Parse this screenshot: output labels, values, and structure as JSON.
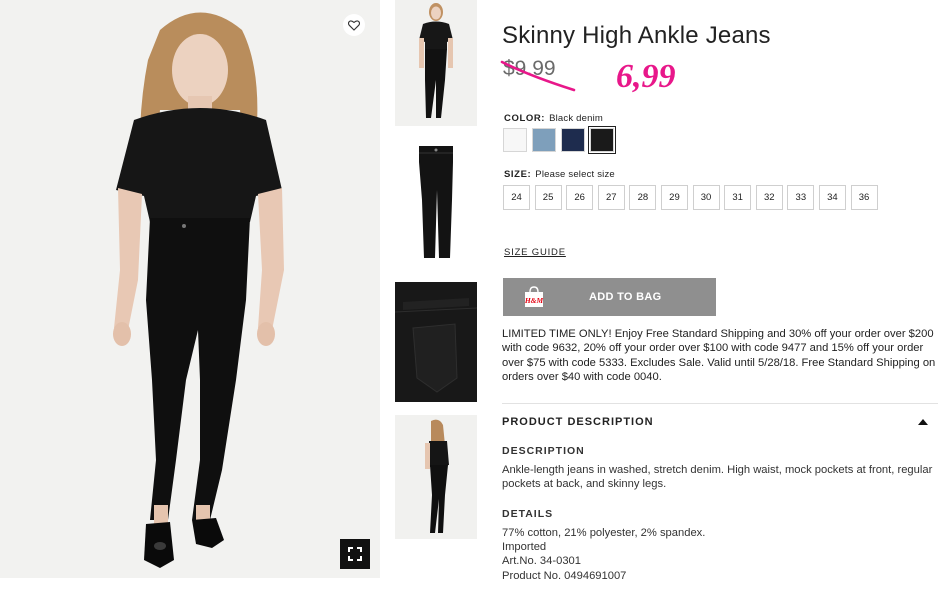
{
  "product": {
    "title": "Skinny High Ankle Jeans",
    "old_price": "$9.99",
    "new_price": "6,99"
  },
  "color": {
    "label": "COLOR:",
    "selected": "Black denim",
    "swatches": [
      {
        "name": "White",
        "hex": "#f7f7f7"
      },
      {
        "name": "Light blue",
        "hex": "#7e9fbb"
      },
      {
        "name": "Dark blue",
        "hex": "#1e2c4e"
      },
      {
        "name": "Black denim",
        "hex": "#1a1a1a"
      }
    ]
  },
  "size": {
    "label": "SIZE:",
    "prompt": "Please select size",
    "options": [
      "24",
      "25",
      "26",
      "27",
      "28",
      "29",
      "30",
      "31",
      "32",
      "33",
      "34",
      "36"
    ]
  },
  "size_guide": "SIZE GUIDE",
  "add_to_bag": {
    "label": "ADD TO BAG",
    "logo_text": "H&M"
  },
  "promo": "LIMITED TIME ONLY! Enjoy Free Standard Shipping and 30% off your order over $200 with code 9632, 20% off your order over $100 with code 9477 and 15% off your order over $75 with code 5333. Excludes Sale. Valid until 5/28/18. Free Standard Shipping on orders over $40 with code 0040.",
  "product_description": {
    "heading": "PRODUCT DESCRIPTION",
    "description_heading": "DESCRIPTION",
    "description": "Ankle-length jeans in washed, stretch denim. High waist, mock pockets at front, regular pockets at back, and skinny legs.",
    "details_heading": "DETAILS",
    "details": [
      "77% cotton, 21% polyester, 2% spandex.",
      "Imported",
      "Art.No. 34-0301",
      "Product No. 0494691007"
    ]
  },
  "icons": {
    "favorite": "heart-icon",
    "zoom": "fullscreen-icon",
    "bag": "shopping-bag-icon",
    "collapse": "caret-up-icon"
  },
  "colors": {
    "accent_price": "#e8178a",
    "strike": "#e8178a",
    "button_bg": "#8f8f8f"
  }
}
